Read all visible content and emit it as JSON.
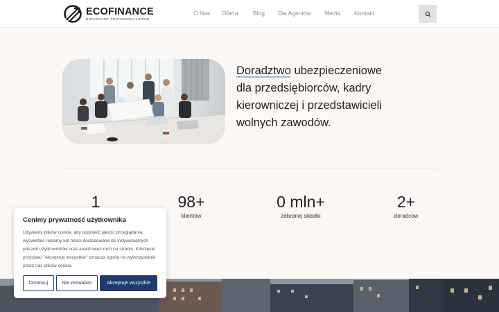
{
  "brand": {
    "name": "ECOFINANCE",
    "tagline": "DORADZAMY PROFESJONALISTOM"
  },
  "nav": {
    "items": [
      "O Nas",
      "Oferta",
      "Blog",
      "Dla Agentów",
      "Media",
      "Kontakt"
    ]
  },
  "hero": {
    "line1": "Doradztwo ubezpieczeniowe",
    "line2": "dla przedsiębiorców, kadry",
    "line3": "kierowniczej i przedstawicieli",
    "line4": "wolnych zawodów."
  },
  "stats": [
    {
      "value": "1",
      "label": ""
    },
    {
      "value": "98+",
      "label": "klientów"
    },
    {
      "value": "0 mln+",
      "label": "zebranej składki"
    },
    {
      "value": "2+",
      "label": "doradców"
    }
  ],
  "cookie": {
    "title": "Cenimy prywatność użytkownika",
    "body": "Używamy plików cookie, aby poprawić jakość przeglądania, wyświetlać reklamy lub treści dostosowane do indywidualnych potrzeb użytkowników oraz analizować ruch na stronie. Kliknięcie przycisku \"Akceptuje wszystkie\" oznacza zgodę na wykorzystanie przez nas plików cookie.",
    "customize": "Dostosuj",
    "reject": "Nie zezwalam",
    "accept": "Akceptuje wszystkie"
  },
  "colors": {
    "accent": "#1f3a6e",
    "background": "#fcf8f6"
  }
}
